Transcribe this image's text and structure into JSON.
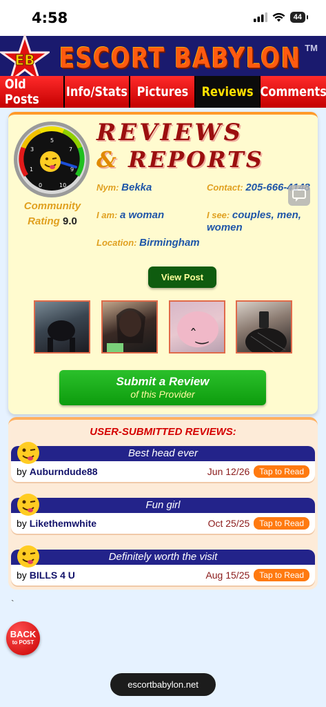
{
  "status": {
    "time": "4:58",
    "battery": "44"
  },
  "header": {
    "logo_text": "EB",
    "title": "ESCORT BABYLON",
    "tm": "TM"
  },
  "nav": [
    {
      "label": "Old Posts",
      "active": false
    },
    {
      "label": "Info/Stats",
      "active": false
    },
    {
      "label": "Pictures",
      "active": false
    },
    {
      "label": "Reviews",
      "active": true
    },
    {
      "label": "Comments",
      "active": false
    }
  ],
  "banner": {
    "line1": "REVIEWS",
    "amp": "&",
    "line2": "REPORTS"
  },
  "gauge": {
    "ticks": [
      "0",
      "1",
      "3",
      "5",
      "7",
      "9",
      "10"
    ]
  },
  "rating": {
    "label_line1": "Community",
    "label_line2": "Rating",
    "value": "9.0"
  },
  "profile": {
    "nym_label": "Nym:",
    "nym": "Bekka",
    "contact_label": "Contact:",
    "contact": "205-666-4148",
    "iam_label": "I am:",
    "iam": "a woman",
    "isee_label": "I see:",
    "isee": "couples, men, women",
    "location_label": "Location:",
    "location": "Birmingham"
  },
  "view_post_label": "View Post",
  "submit": {
    "line1": "Submit a Review",
    "line2": "of this Provider"
  },
  "reviews_header": "USER-SUBMITTED REVIEWS:",
  "reviews": [
    {
      "title": "Best head ever",
      "by": "by",
      "author": "Auburndude88",
      "date": "Jun 12/26",
      "tap": "Tap to Read"
    },
    {
      "title": "Fun girl",
      "by": "by",
      "author": "Likethemwhite",
      "date": "Oct 25/25",
      "tap": "Tap to Read"
    },
    {
      "title": "Definitely worth the visit",
      "by": "by",
      "author": "BILLS 4 U",
      "date": "Aug 15/25",
      "tap": "Tap to Read"
    }
  ],
  "backtick": "`",
  "back": {
    "line1": "BACK",
    "line2": "to POST"
  },
  "url": "escortbabylon.net"
}
